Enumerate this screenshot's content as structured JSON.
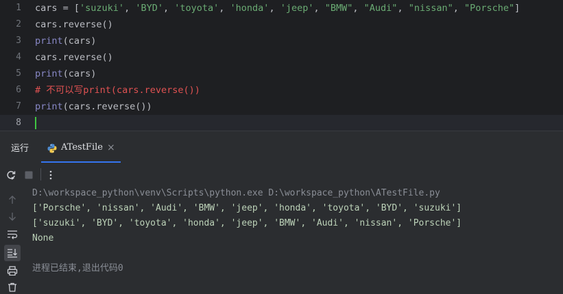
{
  "editor": {
    "lines": [
      {
        "no": "1",
        "parts": [
          {
            "t": "cars = [",
            "c": "plain"
          },
          {
            "t": "'suzuki'",
            "c": "str"
          },
          {
            "t": ", ",
            "c": "plain"
          },
          {
            "t": "'BYD'",
            "c": "str"
          },
          {
            "t": ", ",
            "c": "plain"
          },
          {
            "t": "'toyota'",
            "c": "str"
          },
          {
            "t": ", ",
            "c": "plain"
          },
          {
            "t": "'honda'",
            "c": "str"
          },
          {
            "t": ", ",
            "c": "plain"
          },
          {
            "t": "'jeep'",
            "c": "str"
          },
          {
            "t": ", ",
            "c": "plain"
          },
          {
            "t": "\"BMW\"",
            "c": "str"
          },
          {
            "t": ", ",
            "c": "plain"
          },
          {
            "t": "\"Audi\"",
            "c": "str"
          },
          {
            "t": ", ",
            "c": "plain"
          },
          {
            "t": "\"nissan\"",
            "c": "str"
          },
          {
            "t": ", ",
            "c": "plain"
          },
          {
            "t": "\"Porsche\"",
            "c": "str"
          },
          {
            "t": "]",
            "c": "plain"
          }
        ]
      },
      {
        "no": "2",
        "parts": [
          {
            "t": "cars.reverse()",
            "c": "plain"
          }
        ]
      },
      {
        "no": "3",
        "parts": [
          {
            "t": "print",
            "c": "kw-fn"
          },
          {
            "t": "(cars)",
            "c": "plain"
          }
        ]
      },
      {
        "no": "4",
        "parts": [
          {
            "t": "cars.reverse()",
            "c": "plain"
          }
        ]
      },
      {
        "no": "5",
        "parts": [
          {
            "t": "print",
            "c": "kw-fn"
          },
          {
            "t": "(cars)",
            "c": "plain"
          }
        ]
      },
      {
        "no": "6",
        "parts": [
          {
            "t": "# 不可以写print(cars.reverse())",
            "c": "cmt"
          }
        ]
      },
      {
        "no": "7",
        "parts": [
          {
            "t": "print",
            "c": "kw-fn"
          },
          {
            "t": "(cars.reverse())",
            "c": "plain"
          }
        ]
      },
      {
        "no": "8",
        "parts": []
      }
    ]
  },
  "run_window": {
    "title": "运行",
    "tab_label": "ATestFile",
    "tab_close": "×"
  },
  "console": {
    "command": "D:\\workspace_python\\venv\\Scripts\\python.exe D:\\workspace_python\\ATestFile.py",
    "output": [
      "['Porsche', 'nissan', 'Audi', 'BMW', 'jeep', 'honda', 'toyota', 'BYD', 'suzuki']",
      "['suzuki', 'BYD', 'toyota', 'honda', 'jeep', 'BMW', 'Audi', 'nissan', 'Porsche']",
      "None"
    ],
    "exit_message": "进程已结束,退出代码0"
  },
  "colors": {
    "editor_bg": "#1e1f22",
    "panel_bg": "#2b2d30",
    "string": "#6aab73",
    "comment": "#e05252",
    "builtin": "#8888c6",
    "caret": "#3fc742",
    "accent": "#3574f0"
  }
}
